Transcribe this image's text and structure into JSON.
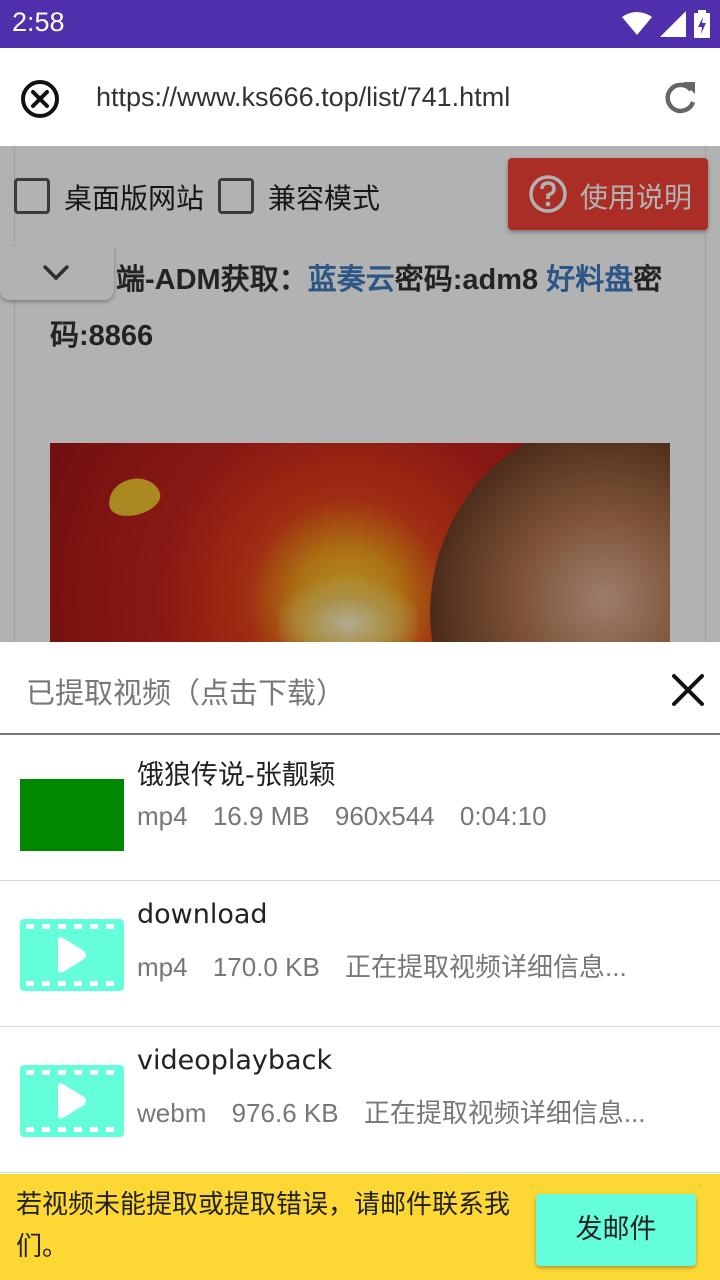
{
  "status_bar": {
    "time": "2:58",
    "icons": [
      "wifi-icon",
      "signal-icon",
      "battery-icon"
    ],
    "background": "#4f2fab"
  },
  "url_bar": {
    "url": "https://www.ks666.top/list/741.html",
    "close_icon": "close-circle-icon",
    "reload_icon": "reload-icon"
  },
  "toolbar": {
    "desktop_checkbox_label": "桌面版网站",
    "desktop_checked": false,
    "compat_checkbox_label": "兼容模式",
    "compat_checked": false,
    "help_button_label": "使用说明",
    "help_button_color": "#f44336"
  },
  "web_page": {
    "text_prefix": "端-ADM获取：",
    "link1": "蓝奏云",
    "text_mid1": "密码:adm8 ",
    "link2": "好料盘",
    "text_mid2": "密码:8866",
    "link_color": "#3e7cc1"
  },
  "sheet": {
    "title": "已提取视频（点击下载）",
    "items": [
      {
        "name": "饿狼传说-张靓颖",
        "format": "mp4",
        "size": "16.9 MB",
        "resolution": "960x544",
        "duration": "0:04:10",
        "thumb": "green-thumbnail",
        "thumb_color": "#008800"
      },
      {
        "name": "download",
        "format": "mp4",
        "size": "170.0 KB",
        "status": "正在提取视频详细信息...",
        "thumb": "video-film-icon",
        "thumb_color": "#64ffda"
      },
      {
        "name": "videoplayback",
        "format": "webm",
        "size": "976.6 KB",
        "status": "正在提取视频详细信息...",
        "thumb": "video-film-icon",
        "thumb_color": "#64ffda"
      }
    ]
  },
  "footer": {
    "message": "若视频未能提取或提取错误，请邮件联系我们。",
    "mail_button_label": "发邮件",
    "background": "#fdd835",
    "button_color": "#64ffda"
  }
}
